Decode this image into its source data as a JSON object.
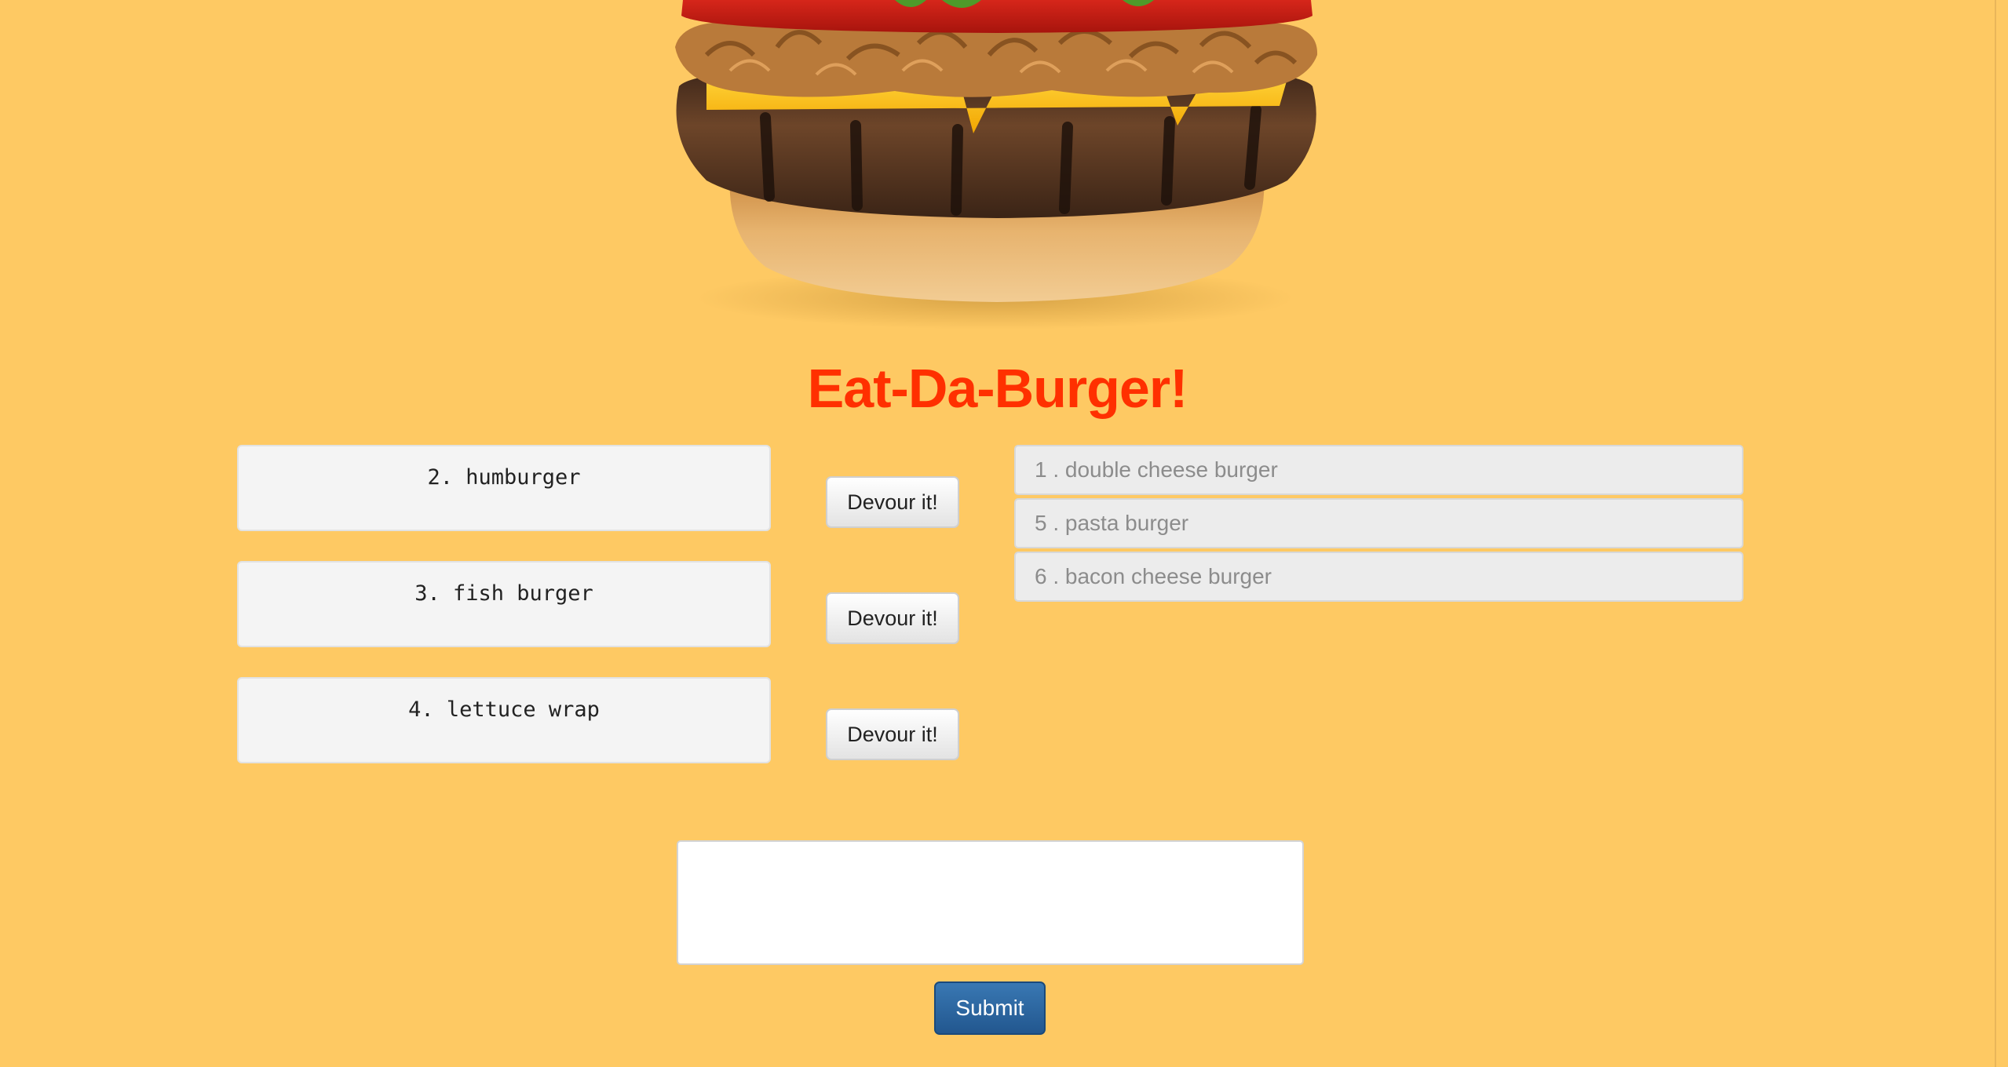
{
  "header": {
    "title": "Eat-Da-Burger!"
  },
  "burgers_to_devour": [
    {
      "name": "2. humburger",
      "button_label": "Devour it!"
    },
    {
      "name": "3. fish burger",
      "button_label": "Devour it!"
    },
    {
      "name": "4. lettuce wrap",
      "button_label": "Devour it!"
    }
  ],
  "devoured_burgers": [
    {
      "label": "1 . double cheese burger"
    },
    {
      "label": "5 . pasta burger"
    },
    {
      "label": "6 . bacon cheese burger"
    }
  ],
  "new_burger_form": {
    "input_value": "",
    "submit_label": "Submit"
  },
  "colors": {
    "page_background": "#fec963",
    "title": "#ff3000",
    "submit_button": "#2c6aa5"
  },
  "icons": {
    "hero_image": "burger-image"
  }
}
